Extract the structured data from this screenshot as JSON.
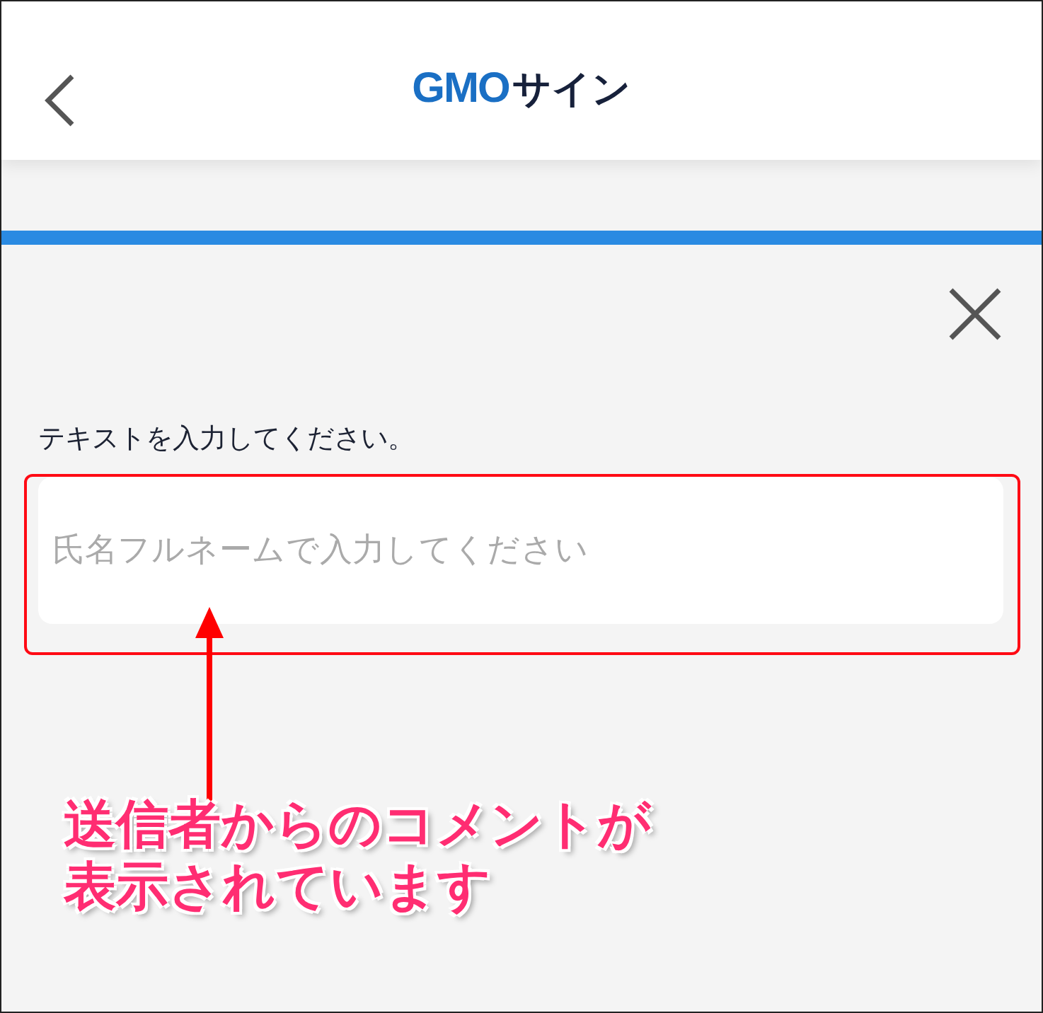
{
  "header": {
    "logo_mark": "GMO",
    "logo_text": "サイン"
  },
  "progress": {
    "level": 1
  },
  "prompt": "テキストを入力してください。",
  "field": {
    "placeholder": "氏名フルネームで入力してください"
  },
  "callout": {
    "text": "送信者からのコメントが表示されています"
  }
}
